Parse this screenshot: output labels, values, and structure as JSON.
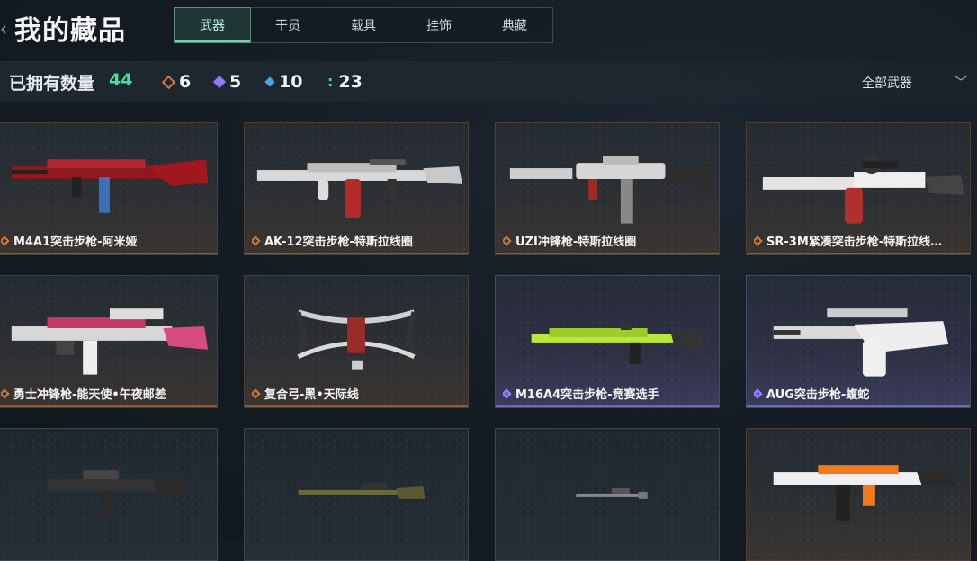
{
  "header": {
    "back_icon": "chevron-left-icon",
    "title": "我的藏品",
    "tabs": [
      {
        "label": "武器",
        "active": true
      },
      {
        "label": "干员"
      },
      {
        "label": "载具"
      },
      {
        "label": "挂饰"
      },
      {
        "label": "典藏"
      }
    ]
  },
  "stats": {
    "owned_label": "已拥有数量",
    "owned_count": "44",
    "rarities": [
      {
        "icon": "orange-diamond-icon",
        "color": "#d27b3c",
        "count": "6"
      },
      {
        "icon": "purple-diamond-icon",
        "color": "#8f78ff",
        "count": "5"
      },
      {
        "icon": "blue-diamond-icon",
        "color": "#4aa3e8",
        "count": "10"
      },
      {
        "icon": "green-dots-icon",
        "color": "#45d39a",
        "count": "23"
      }
    ],
    "filter_label": "全部武器"
  },
  "cards": [
    {
      "name": "M4A1突击步枪-阿米娅",
      "rarity": "orange",
      "accent": "#c0252b"
    },
    {
      "name": "AK-12突击步枪-特斯拉线圈",
      "rarity": "orange",
      "accent": "#d8d8d8"
    },
    {
      "name": "UZI冲锋枪-特斯拉线圈",
      "rarity": "orange",
      "accent": "#cfcfcf"
    },
    {
      "name": "SR-3M紧凑突击步枪-特斯拉线…",
      "rarity": "orange",
      "accent": "#e0e0e0"
    },
    {
      "name": "勇士冲锋枪-能天使•午夜邮差",
      "rarity": "orange",
      "accent": "#d64c7c"
    },
    {
      "name": "复合弓-黑•天际线",
      "rarity": "orange",
      "accent": "#d9d9d9"
    },
    {
      "name": "M16A4突击步枪-竞赛选手",
      "rarity": "purple",
      "accent": "#b8e83a"
    },
    {
      "name": "AUG突击步枪-蝮蛇",
      "rarity": "purple",
      "accent": "#e6e6e6"
    },
    {
      "name": "",
      "rarity": "blue",
      "accent": "#777"
    },
    {
      "name": "",
      "rarity": "blue",
      "accent": "#6b6b3a"
    },
    {
      "name": "",
      "rarity": "blue",
      "accent": "#888"
    },
    {
      "name": "",
      "rarity": "orange",
      "accent": "#f07a1c"
    }
  ]
}
